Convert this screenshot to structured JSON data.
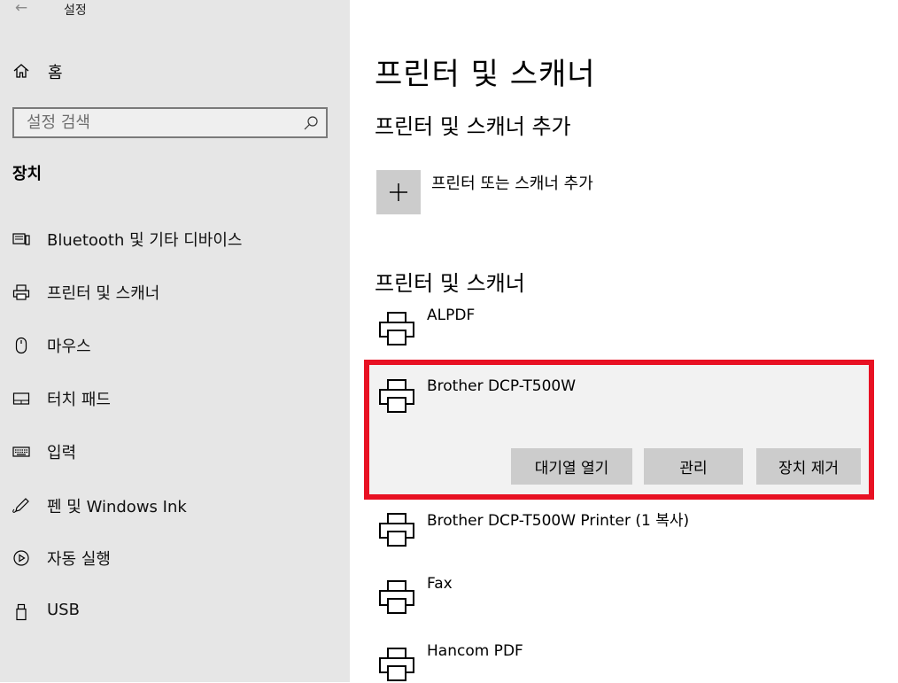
{
  "window": {
    "title": "설정"
  },
  "sidebar": {
    "home_label": "홈",
    "search_placeholder": "설정 검색",
    "section_title": "장치",
    "items": [
      {
        "label": "Bluetooth 및 기타 디바이스",
        "icon": "bluetooth-devices-icon"
      },
      {
        "label": "프린터 및 스캐너",
        "icon": "printer-icon"
      },
      {
        "label": "마우스",
        "icon": "mouse-icon"
      },
      {
        "label": "터치 패드",
        "icon": "touchpad-icon"
      },
      {
        "label": "입력",
        "icon": "keyboard-icon"
      },
      {
        "label": "펜 및 Windows Ink",
        "icon": "pen-icon"
      },
      {
        "label": "자동 실행",
        "icon": "autoplay-icon"
      },
      {
        "label": "USB",
        "icon": "usb-icon"
      }
    ]
  },
  "main": {
    "title": "프린터 및 스캐너",
    "add_section_title": "프린터 및 스캐너 추가",
    "add_button_label": "프린터 또는 스캐너 추가",
    "list_title": "프린터 및 스캐너",
    "printers": [
      {
        "name": "ALPDF"
      },
      {
        "name": "Brother DCP-T500W",
        "selected": true
      },
      {
        "name": "Brother DCP-T500W Printer (1 복사)"
      },
      {
        "name": "Fax"
      },
      {
        "name": "Hancom PDF"
      }
    ],
    "selected_actions": {
      "open_queue": "대기열 열기",
      "manage": "관리",
      "remove": "장치 제거"
    }
  },
  "colors": {
    "sidebar_bg": "#e6e6e6",
    "highlight_border": "#e81123",
    "button_bg": "#cccccc",
    "selected_bg": "#f2f2f2"
  }
}
